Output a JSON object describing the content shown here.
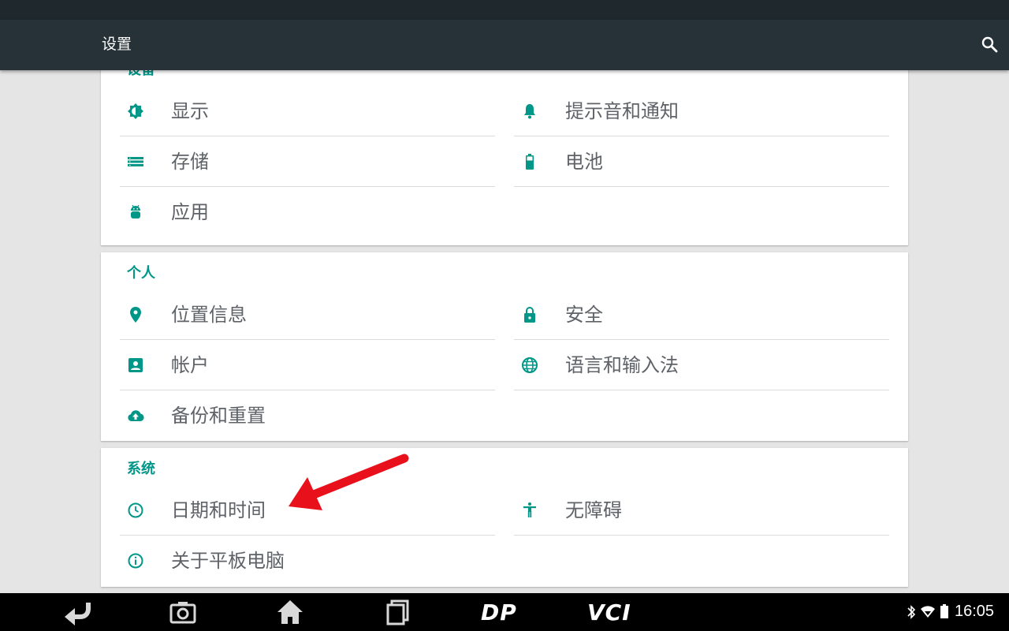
{
  "app": {
    "title": "设置"
  },
  "sections": {
    "device": {
      "title": "设备",
      "display": "显示",
      "notifications": "提示音和通知",
      "storage": "存储",
      "battery": "电池",
      "apps": "应用"
    },
    "personal": {
      "title": "个人",
      "location": "位置信息",
      "security": "安全",
      "accounts": "帐户",
      "language": "语言和输入法",
      "backup": "备份和重置"
    },
    "system": {
      "title": "系统",
      "datetime": "日期和时间",
      "accessibility": "无障碍",
      "about": "关于平板电脑"
    }
  },
  "navbar": {
    "brand1": "DP",
    "brand2": "VCI"
  },
  "status": {
    "time": "16:05"
  },
  "colors": {
    "accent": "#009688",
    "appbar": "#263238",
    "annotation": "#e8101a"
  }
}
